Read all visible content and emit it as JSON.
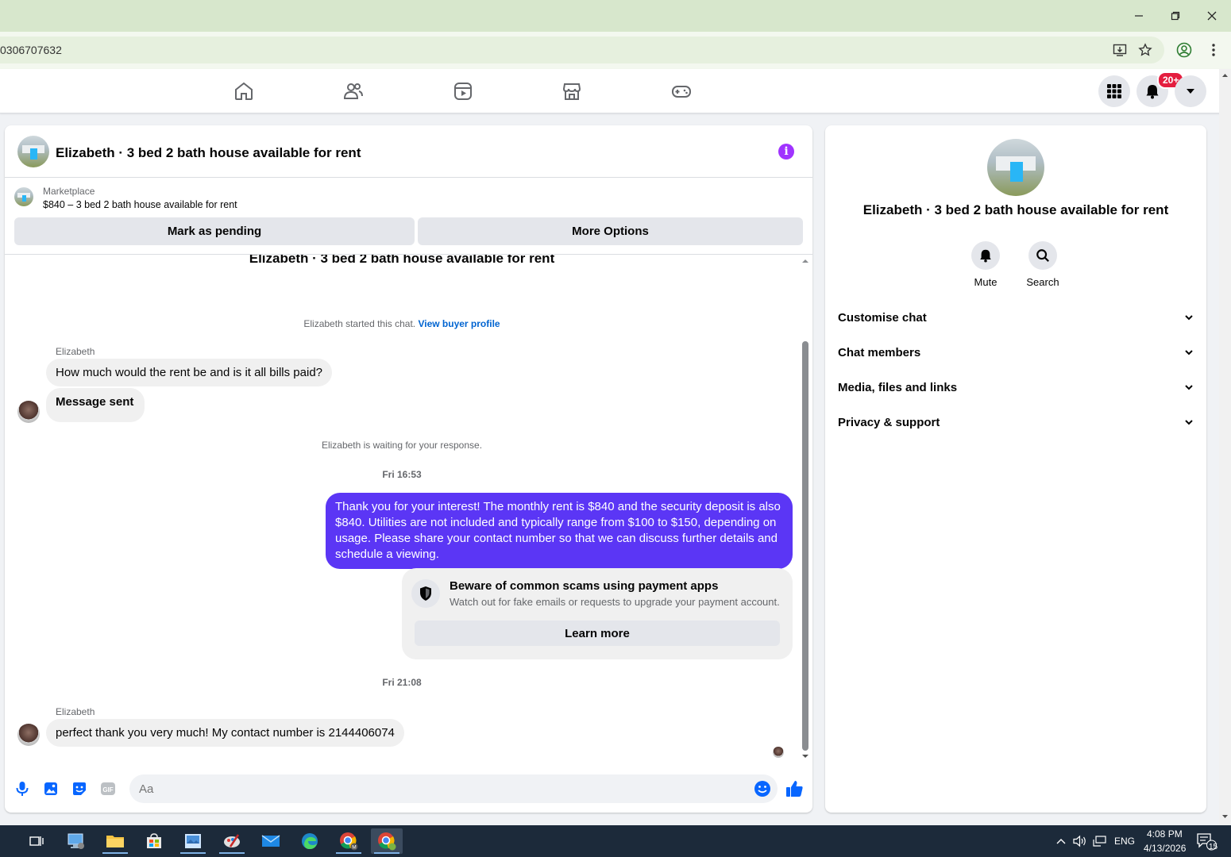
{
  "browser": {
    "url_fragment": "0306707632"
  },
  "fb_nav": {
    "notification_count": "20+"
  },
  "chat": {
    "title": "Elizabeth · 3 bed 2 bath house available for rent",
    "marketplace_label": "Marketplace",
    "listing": "$840 – 3 bed 2 bath house available for rent",
    "mark_pending_label": "Mark as pending",
    "more_options_label": "More Options",
    "scrolled_title": "Elizabeth · 3 bed 2 bath house available for rent",
    "started_text": "Elizabeth started this chat. ",
    "view_buyer_profile": "View buyer profile",
    "messages": {
      "sender1": "Elizabeth",
      "in1": "How much would the rent be and is it all bills paid?",
      "in2": "Message sent",
      "waiting": "Elizabeth is waiting for your response.",
      "time1": "Fri 16:53",
      "out1": "Thank you for your interest! The monthly rent is $840 and the security deposit is also $840. Utilities are not included and typically range from $100 to $150, depending on usage. Please share your contact number so that we can discuss further details and schedule a viewing.",
      "time2": "Fri 21:08",
      "sender2": "Elizabeth",
      "in3": "perfect thank you very much! My contact number is 2144406074"
    },
    "scam": {
      "title": "Beware of common scams using payment apps",
      "desc": "Watch out for fake emails or requests to upgrade your payment account.",
      "learn_more": "Learn more"
    },
    "composer": {
      "placeholder": "Aa"
    }
  },
  "right_panel": {
    "name": "Elizabeth · 3 bed 2 bath house available for rent",
    "mute_label": "Mute",
    "search_label": "Search",
    "sections": [
      "Customise chat",
      "Chat members",
      "Media, files and links",
      "Privacy & support"
    ]
  },
  "taskbar": {
    "language": "ENG",
    "time": "4:08 PM",
    "date": "4/13/2026",
    "notifications": "15"
  }
}
